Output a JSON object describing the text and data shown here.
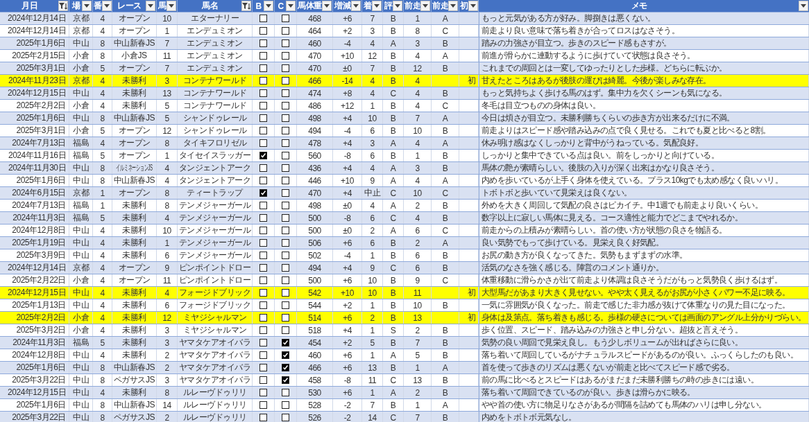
{
  "columns": [
    {
      "label": "月日",
      "filtered": true
    },
    {
      "label": "場",
      "filtered": false
    },
    {
      "label": "番",
      "filtered": false
    },
    {
      "label": "レース",
      "filtered": false
    },
    {
      "label": "馬",
      "filtered": false
    },
    {
      "label": "馬名",
      "filtered": true
    },
    {
      "label": "B",
      "filtered": false
    },
    {
      "label": "C",
      "filtered": false
    },
    {
      "label": "馬体重",
      "filtered": false
    },
    {
      "label": "増減",
      "filtered": false
    },
    {
      "label": "着",
      "filtered": false
    },
    {
      "label": "評",
      "filtered": false
    },
    {
      "label": "前走",
      "filtered": false
    },
    {
      "label": "前走",
      "filtered": false
    },
    {
      "label": "初",
      "filtered": false
    },
    {
      "label": "メモ",
      "filtered": false
    }
  ],
  "rows": [
    {
      "date": "2024年12月14日",
      "venue": "京都",
      "number": "4",
      "race": "オープン",
      "gate": "10",
      "horse": "エターナリー",
      "b": false,
      "c": false,
      "weight": "468",
      "change": "+6",
      "finish": "7",
      "grade": "B",
      "prev_finish": "1",
      "prev_grade": "A",
      "highlighted": false,
      "memo": "もっと元気がある方が好み。脚捌きは悪くない。"
    },
    {
      "date": "2024年12月14日",
      "venue": "京都",
      "number": "4",
      "race": "オープン",
      "gate": "1",
      "horse": "エンデュミオン",
      "b": false,
      "c": false,
      "weight": "464",
      "change": "+2",
      "finish": "3",
      "grade": "B",
      "prev_finish": "8",
      "prev_grade": "C",
      "highlighted": false,
      "memo": "前走より良い意味で落ち着きが合ってロスはなさそう。"
    },
    {
      "date": "2025年1月6日",
      "venue": "中山",
      "number": "8",
      "race": "中山新春JS",
      "gate": "7",
      "horse": "エンデュミオン",
      "b": false,
      "c": false,
      "weight": "460",
      "change": "-4",
      "finish": "4",
      "grade": "A",
      "prev_finish": "3",
      "prev_grade": "B",
      "highlighted": false,
      "memo": "踏みの力強さが目立つ。歩きのスピード感もさすが。"
    },
    {
      "date": "2025年2月15日",
      "venue": "小倉",
      "number": "8",
      "race": "小倉JS",
      "gate": "11",
      "horse": "エンデュミオン",
      "b": false,
      "c": false,
      "weight": "470",
      "change": "+10",
      "finish": "12",
      "grade": "B",
      "prev_finish": "4",
      "prev_grade": "A",
      "highlighted": false,
      "memo": "前進が滑らかに連動するように歩けていて状態は良さそう。"
    },
    {
      "date": "2025年3月1日",
      "venue": "小倉",
      "number": "5",
      "race": "オープン",
      "gate": "7",
      "horse": "エンデュミオン",
      "b": false,
      "c": false,
      "weight": "470",
      "change": "±0",
      "finish": "7",
      "grade": "B",
      "prev_finish": "12",
      "prev_grade": "B",
      "highlighted": false,
      "memo": "これまでの周回とは一変してゆったりとした歩様。どちらに転ぶか。"
    },
    {
      "date": "2024年11月23日",
      "venue": "京都",
      "number": "4",
      "race": "未勝利",
      "gate": "3",
      "horse": "コンテナワールド",
      "b": false,
      "c": false,
      "weight": "466",
      "change": "-14",
      "finish": "4",
      "grade": "B",
      "prev_finish": "4",
      "first": "初",
      "highlighted": true,
      "memo": "甘えたところはあるが後肢の運びは綺麗。今後が楽しみな存在。"
    },
    {
      "date": "2024年12月15日",
      "venue": "中山",
      "number": "4",
      "race": "未勝利",
      "gate": "13",
      "horse": "コンテナワールド",
      "b": false,
      "c": false,
      "weight": "474",
      "change": "+8",
      "finish": "4",
      "grade": "C",
      "prev_finish": "4",
      "prev_grade": "B",
      "highlighted": false,
      "memo": "もっと気持ちよく歩ける馬のはず。集中力を欠くシーンも気になる。"
    },
    {
      "date": "2025年2月2日",
      "venue": "小倉",
      "number": "4",
      "race": "未勝利",
      "gate": "5",
      "horse": "コンテナワールド",
      "b": false,
      "c": false,
      "weight": "486",
      "change": "+12",
      "finish": "1",
      "grade": "B",
      "prev_finish": "4",
      "prev_grade": "C",
      "highlighted": false,
      "memo": "冬毛は目立つものの身体は良い。"
    },
    {
      "date": "2025年1月6日",
      "venue": "中山",
      "number": "8",
      "race": "中山新春JS",
      "gate": "5",
      "horse": "シャンドゥレール",
      "b": false,
      "c": false,
      "weight": "498",
      "change": "+4",
      "finish": "10",
      "grade": "B",
      "prev_finish": "7",
      "prev_grade": "A",
      "highlighted": false,
      "memo": "今日は煩さが目立つ。未勝利勝ちくらいの歩き方が出来るだけに不満。"
    },
    {
      "date": "2025年3月1日",
      "venue": "小倉",
      "number": "5",
      "race": "オープン",
      "gate": "12",
      "horse": "シャンドゥレール",
      "b": false,
      "c": false,
      "weight": "494",
      "change": "-4",
      "finish": "6",
      "grade": "B",
      "prev_finish": "10",
      "prev_grade": "B",
      "highlighted": false,
      "memo": "前走よりはスピード感や踏み込みの点で良く見せる。これでも夏と比べると8割。"
    },
    {
      "date": "2024年7月13日",
      "venue": "福島",
      "number": "4",
      "race": "オープン",
      "gate": "8",
      "horse": "タイキフロリゼル",
      "b": false,
      "c": false,
      "weight": "478",
      "change": "+4",
      "finish": "3",
      "grade": "A",
      "prev_finish": "4",
      "prev_grade": "A",
      "highlighted": false,
      "memo": "休み明け感はなくしっかりと背中がうねっている。気配良好。"
    },
    {
      "date": "2024年11月16日",
      "venue": "福島",
      "number": "5",
      "race": "オープン",
      "gate": "1",
      "horse": "タイセイスラッガー",
      "b": true,
      "c": false,
      "weight": "560",
      "change": "-8",
      "finish": "6",
      "grade": "B",
      "prev_finish": "1",
      "prev_grade": "B",
      "highlighted": false,
      "memo": "しっかりと集中できている点は良い。前をしっかりと向けている。"
    },
    {
      "date": "2024年11月30日",
      "venue": "中山",
      "number": "8",
      "race": "イルミネーションJS",
      "race_small": true,
      "gate": "4",
      "horse": "タンジェントアーク",
      "b": false,
      "c": false,
      "weight": "436",
      "change": "+4",
      "finish": "4",
      "grade": "A",
      "prev_finish": "3",
      "prev_grade": "B",
      "highlighted": false,
      "memo": "馬体の艶が素晴らしい。後肢の入りが深く出来はかなり良さそう。"
    },
    {
      "date": "2025年1月6日",
      "venue": "中山",
      "number": "8",
      "race": "中山新春JS",
      "gate": "4",
      "horse": "タンジェントアーク",
      "b": false,
      "c": false,
      "weight": "446",
      "change": "+10",
      "finish": "9",
      "grade": "A",
      "prev_finish": "4",
      "prev_grade": "A",
      "highlighted": false,
      "memo": "内めを歩いているが上手く身体を使えている。プラス10kgでも太め感なく良いハリ。"
    },
    {
      "date": "2024年6月15日",
      "venue": "京都",
      "number": "1",
      "race": "オープン",
      "gate": "8",
      "horse": "ティートラップ",
      "b": true,
      "c": false,
      "weight": "470",
      "change": "+4",
      "finish": "中止",
      "grade": "C",
      "prev_finish": "10",
      "prev_grade": "C",
      "highlighted": false,
      "memo": "トボトボと歩いていて見栄えは良くない。"
    },
    {
      "date": "2024年7月13日",
      "venue": "福島",
      "number": "1",
      "race": "未勝利",
      "gate": "8",
      "horse": "テンメジャーガール",
      "b": false,
      "c": false,
      "weight": "498",
      "change": "±0",
      "finish": "4",
      "grade": "A",
      "prev_finish": "2",
      "prev_grade": "B",
      "highlighted": false,
      "memo": "外めを大きく周回して気配の良さはピカイチ。中1週でも前走より良いくらい。"
    },
    {
      "date": "2024年11月3日",
      "venue": "福島",
      "number": "5",
      "race": "未勝利",
      "gate": "4",
      "horse": "テンメジャーガール",
      "b": false,
      "c": false,
      "weight": "500",
      "change": "-8",
      "finish": "6",
      "grade": "C",
      "prev_finish": "4",
      "prev_grade": "B",
      "highlighted": false,
      "memo": "数字以上に寂しい馬体に見える。コース適性と能力でどこまでやれるか。"
    },
    {
      "date": "2024年12月8日",
      "venue": "中山",
      "number": "4",
      "race": "未勝利",
      "gate": "10",
      "horse": "テンメジャーガール",
      "b": false,
      "c": false,
      "weight": "500",
      "change": "±0",
      "finish": "2",
      "grade": "A",
      "prev_finish": "6",
      "prev_grade": "C",
      "highlighted": false,
      "memo": "前走からの上積みが素晴らしい。首の使い方が状態の良さを物語る。"
    },
    {
      "date": "2025年1月19日",
      "venue": "中山",
      "number": "4",
      "race": "未勝利",
      "gate": "1",
      "horse": "テンメジャーガール",
      "b": false,
      "c": false,
      "weight": "506",
      "change": "+6",
      "finish": "6",
      "grade": "B",
      "prev_finish": "2",
      "prev_grade": "A",
      "highlighted": false,
      "memo": "良い気勢でもって歩けている。見栄え良く好気配。"
    },
    {
      "date": "2025年3月9日",
      "venue": "中山",
      "number": "4",
      "race": "未勝利",
      "gate": "6",
      "horse": "テンメジャーガール",
      "b": false,
      "c": false,
      "weight": "502",
      "change": "-4",
      "finish": "1",
      "grade": "B",
      "prev_finish": "6",
      "prev_grade": "B",
      "highlighted": false,
      "memo": "お尻の動き方が良くなってきた。気勢もまずまずの水準。"
    },
    {
      "date": "2024年12月14日",
      "venue": "京都",
      "number": "4",
      "race": "オープン",
      "gate": "9",
      "horse": "ピンポイントドロー",
      "b": false,
      "c": false,
      "weight": "494",
      "change": "+4",
      "finish": "9",
      "grade": "C",
      "prev_finish": "6",
      "prev_grade": "B",
      "highlighted": false,
      "memo": "活気のなさを強く感じる。陣営のコメント通りか。"
    },
    {
      "date": "2025年2月22日",
      "venue": "小倉",
      "number": "4",
      "race": "オープン",
      "gate": "11",
      "horse": "ピンポイントドロー",
      "b": false,
      "c": false,
      "weight": "500",
      "change": "+6",
      "finish": "10",
      "grade": "B",
      "prev_finish": "9",
      "prev_grade": "C",
      "highlighted": false,
      "memo": "体重移動に滑らかさが出て前走より体調は良さそうだがもっと気勢良く歩けるはず。"
    },
    {
      "date": "2024年12月15日",
      "venue": "中山",
      "number": "4",
      "race": "未勝利",
      "gate": "4",
      "horse": "フォージドブリック",
      "b": false,
      "c": false,
      "weight": "542",
      "change": "+10",
      "finish": "10",
      "grade": "B",
      "prev_finish": "11",
      "first": "初",
      "highlighted": true,
      "memo": "大型馬だがあまり大きく見せない。やや太く見えるがお尻が小さくパワー不足に映る。"
    },
    {
      "date": "2025年1月13日",
      "venue": "中山",
      "number": "4",
      "race": "未勝利",
      "gate": "6",
      "horse": "フォージドブリック",
      "b": false,
      "c": false,
      "weight": "544",
      "change": "+2",
      "finish": "1",
      "grade": "B",
      "prev_finish": "10",
      "prev_grade": "B",
      "highlighted": false,
      "memo": "一気に雰囲気が良くなった。前走で感じた非力感が抜けて体重なりの見た目になった。"
    },
    {
      "date": "2025年2月2日",
      "venue": "小倉",
      "number": "4",
      "race": "未勝利",
      "gate": "12",
      "horse": "ミヤジシャルマン",
      "b": false,
      "c": false,
      "weight": "514",
      "change": "+6",
      "finish": "2",
      "grade": "B",
      "prev_finish": "13",
      "first": "初",
      "highlighted": true,
      "memo": "身体は及第点。落ち着きも感じる。歩様の硬さについては画面のアングル上分かりづらい。"
    },
    {
      "date": "2025年3月2日",
      "venue": "小倉",
      "number": "4",
      "race": "未勝利",
      "gate": "3",
      "horse": "ミヤジシャルマン",
      "b": false,
      "c": false,
      "weight": "518",
      "change": "+4",
      "finish": "1",
      "grade": "S",
      "prev_finish": "2",
      "prev_grade": "B",
      "highlighted": false,
      "memo": "歩く位置、スピード、踏み込みの力強さと申し分ない。超抜と言えそう。"
    },
    {
      "date": "2024年11月3日",
      "venue": "福島",
      "number": "5",
      "race": "未勝利",
      "gate": "3",
      "horse": "ヤマタケアオイバラ",
      "b": false,
      "c": true,
      "weight": "454",
      "change": "+2",
      "finish": "5",
      "grade": "B",
      "prev_finish": "7",
      "prev_grade": "B",
      "highlighted": false,
      "memo": "気勢の良い周回で見栄え良し。もう少しボリュームが出ればさらに良い。"
    },
    {
      "date": "2024年12月8日",
      "venue": "中山",
      "number": "4",
      "race": "未勝利",
      "gate": "2",
      "horse": "ヤマタケアオイバラ",
      "b": false,
      "c": true,
      "weight": "460",
      "change": "+6",
      "finish": "1",
      "grade": "A",
      "prev_finish": "5",
      "prev_grade": "B",
      "highlighted": false,
      "memo": "落ち着いて周回しているがナチュラルスピードがあるのが良い。ふっくらしたのも良い。"
    },
    {
      "date": "2025年1月6日",
      "venue": "中山",
      "number": "8",
      "race": "中山新春JS",
      "gate": "2",
      "horse": "ヤマタケアオイバラ",
      "b": false,
      "c": true,
      "weight": "466",
      "change": "+6",
      "finish": "13",
      "grade": "B",
      "prev_finish": "1",
      "prev_grade": "A",
      "highlighted": false,
      "memo": "首を使って歩きのリズムは悪くないが前走と比べてスピード感で劣る。"
    },
    {
      "date": "2025年3月22日",
      "venue": "中山",
      "number": "8",
      "race": "ペガサスJS",
      "gate": "3",
      "horse": "ヤマタケアオイバラ",
      "b": false,
      "c": true,
      "weight": "458",
      "change": "-8",
      "finish": "11",
      "grade": "C",
      "prev_finish": "13",
      "prev_grade": "B",
      "highlighted": false,
      "memo": "前の馬に比べるとスピードはあるがまだまだ未勝利勝ちの時の歩きには遠い。"
    },
    {
      "date": "2024年12月15日",
      "venue": "中山",
      "number": "4",
      "race": "未勝利",
      "gate": "8",
      "horse": "ルレーヴドゥリリ",
      "b": false,
      "c": false,
      "weight": "530",
      "change": "+6",
      "finish": "1",
      "grade": "A",
      "prev_finish": "2",
      "prev_grade": "B",
      "highlighted": false,
      "memo": "落ち着いて周回できているのが良い。歩きは滑らかに映る。"
    },
    {
      "date": "2025年1月6日",
      "venue": "中山",
      "number": "8",
      "race": "中山新春JS",
      "gate": "14",
      "horse": "ルレーヴドゥリリ",
      "b": false,
      "c": false,
      "weight": "528",
      "change": "-2",
      "finish": "7",
      "grade": "B",
      "prev_finish": "1",
      "prev_grade": "A",
      "highlighted": false,
      "memo": "やや首の使い方に物足りなさがあるが間隔を詰めても馬体のハリは申し分ない。"
    },
    {
      "date": "2025年3月22日",
      "venue": "中山",
      "number": "8",
      "race": "ペガサスJS",
      "gate": "2",
      "horse": "ルレーヴドゥリリ",
      "b": false,
      "c": false,
      "weight": "526",
      "change": "-2",
      "finish": "14",
      "grade": "C",
      "prev_finish": "7",
      "prev_grade": "B",
      "highlighted": false,
      "memo": "内めをトボトボ元気なし。"
    }
  ]
}
